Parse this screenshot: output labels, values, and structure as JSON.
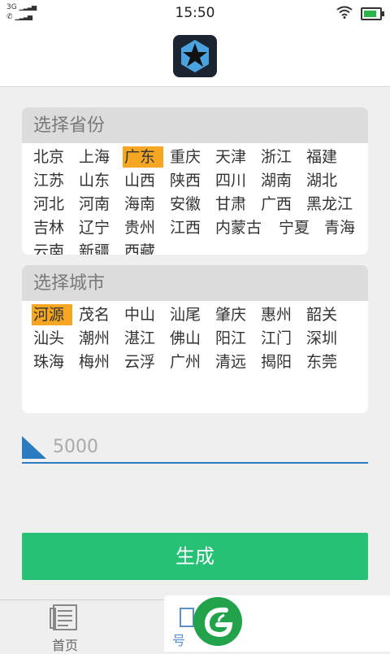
{
  "status": {
    "network1": "3G",
    "network2": "",
    "time": "15:50"
  },
  "province_panel": {
    "title": "选择省份",
    "items": [
      {
        "label": "北京",
        "selected": false
      },
      {
        "label": "上海",
        "selected": false
      },
      {
        "label": "广东",
        "selected": true
      },
      {
        "label": "重庆",
        "selected": false
      },
      {
        "label": "天津",
        "selected": false
      },
      {
        "label": "浙江",
        "selected": false
      },
      {
        "label": "福建",
        "selected": false
      },
      {
        "label": "江苏",
        "selected": false
      },
      {
        "label": "山东",
        "selected": false
      },
      {
        "label": "山西",
        "selected": false
      },
      {
        "label": "陕西",
        "selected": false
      },
      {
        "label": "四川",
        "selected": false
      },
      {
        "label": "湖南",
        "selected": false
      },
      {
        "label": "湖北",
        "selected": false
      },
      {
        "label": "河北",
        "selected": false
      },
      {
        "label": "河南",
        "selected": false
      },
      {
        "label": "海南",
        "selected": false
      },
      {
        "label": "安徽",
        "selected": false
      },
      {
        "label": "甘肃",
        "selected": false
      },
      {
        "label": "广西",
        "selected": false
      },
      {
        "label": "黑龙江",
        "selected": false
      },
      {
        "label": "吉林",
        "selected": false
      },
      {
        "label": "辽宁",
        "selected": false
      },
      {
        "label": "贵州",
        "selected": false
      },
      {
        "label": "江西",
        "selected": false
      },
      {
        "label": "内蒙古",
        "selected": false
      },
      {
        "label": "宁夏",
        "selected": false
      },
      {
        "label": "青海",
        "selected": false
      },
      {
        "label": "云南",
        "selected": false
      },
      {
        "label": "新疆",
        "selected": false
      },
      {
        "label": "西藏",
        "selected": false
      }
    ]
  },
  "city_panel": {
    "title": "选择城市",
    "items": [
      {
        "label": "河源",
        "selected": true
      },
      {
        "label": "茂名",
        "selected": false
      },
      {
        "label": "中山",
        "selected": false
      },
      {
        "label": "汕尾",
        "selected": false
      },
      {
        "label": "肇庆",
        "selected": false
      },
      {
        "label": "惠州",
        "selected": false
      },
      {
        "label": "韶关",
        "selected": false
      },
      {
        "label": "汕头",
        "selected": false
      },
      {
        "label": "潮州",
        "selected": false
      },
      {
        "label": "湛江",
        "selected": false
      },
      {
        "label": "佛山",
        "selected": false
      },
      {
        "label": "阳江",
        "selected": false
      },
      {
        "label": "江门",
        "selected": false
      },
      {
        "label": "深圳",
        "selected": false
      },
      {
        "label": "珠海",
        "selected": false
      },
      {
        "label": "梅州",
        "selected": false
      },
      {
        "label": "云浮",
        "selected": false
      },
      {
        "label": "广州",
        "selected": false
      },
      {
        "label": "清远",
        "selected": false
      },
      {
        "label": "揭阳",
        "selected": false
      },
      {
        "label": "东莞",
        "selected": false
      }
    ]
  },
  "count_input": {
    "value": "5000",
    "placeholder": ""
  },
  "generate_button": {
    "label": "生成"
  },
  "tabbar": {
    "tab_home": "首页",
    "tab_number": "号"
  },
  "colors": {
    "selected": "#f5a623",
    "accent_blue": "#2b7bc0",
    "button_green": "#26c175"
  }
}
